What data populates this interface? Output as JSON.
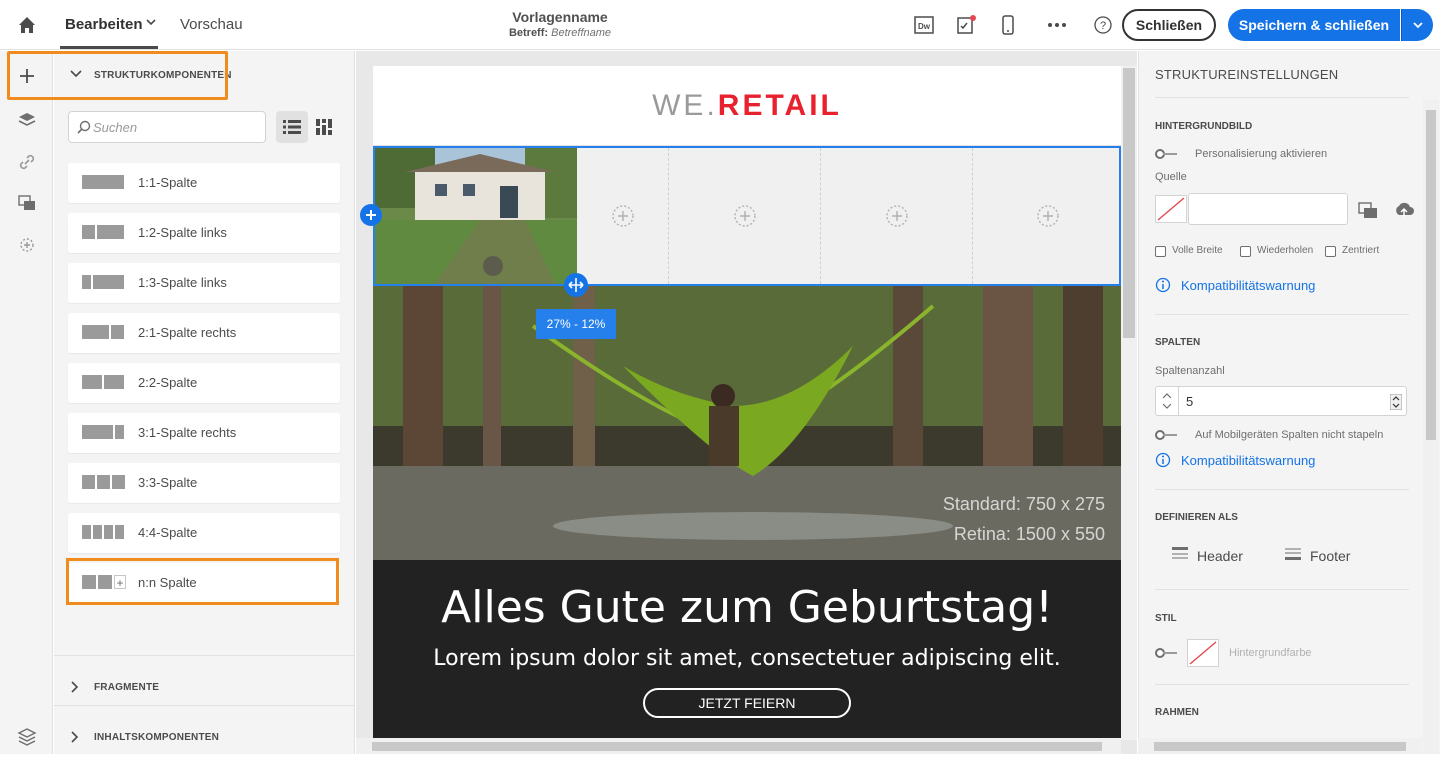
{
  "topbar": {
    "tab_edit": "Bearbeiten",
    "tab_preview": "Vorschau",
    "template_name": "Vorlagenname",
    "subject_label": "Betreff:",
    "subject_value": "Betreffname",
    "close_label": "Schließen",
    "save_label": "Speichern & schließen",
    "accent": "#1473e6"
  },
  "left_rail": {
    "icons": [
      "add-icon",
      "layers-icon",
      "link-icon",
      "image-assets-icon",
      "personalization-icon",
      "help-layers-icon"
    ]
  },
  "panel": {
    "section_structure": "STRUKTURKOMPONENTEN",
    "search_placeholder": "Suchen",
    "components": [
      {
        "label": "1:1-Spalte",
        "cols": [
          1
        ]
      },
      {
        "label": "1:2-Spalte links",
        "cols": [
          1,
          2
        ]
      },
      {
        "label": "1:3-Spalte links",
        "cols": [
          1,
          3
        ]
      },
      {
        "label": "2:1-Spalte rechts",
        "cols": [
          2,
          1
        ]
      },
      {
        "label": "2:2-Spalte",
        "cols": [
          1,
          1
        ]
      },
      {
        "label": "3:1-Spalte rechts",
        "cols": [
          3,
          1
        ]
      },
      {
        "label": "3:3-Spalte",
        "cols": [
          1,
          1,
          1
        ]
      },
      {
        "label": "4:4-Spalte",
        "cols": [
          1,
          1,
          1,
          1
        ]
      },
      {
        "label": "n:n Spalte",
        "cols": [
          1,
          1
        ]
      }
    ],
    "section_fragments": "FRAGMENTE",
    "section_content": "INHALTSKOMPONENTEN",
    "highlight_color": "#f08c1e"
  },
  "canvas": {
    "logo_we": "WE",
    "logo_dot": ".",
    "logo_retail": "RETAIL",
    "logo_accent": "#e8212e",
    "resize_tooltip": "27% - 12%",
    "image_text_standard": "Standard: 750 x 275",
    "image_text_retina": "Retina: 1500 x 550",
    "headline": "Alles Gute zum Geburtstag!",
    "paragraph": "Lorem ipsum dolor sit amet, consectetuer adipiscing elit.",
    "cta": "JETZT FEIERN"
  },
  "right_panel": {
    "title": "STRUKTUREINSTELLUNGEN",
    "bg_image_section": "HINTERGRUNDBILD",
    "personalization_toggle": "Personalisierung aktivieren",
    "source_label": "Quelle",
    "source_value": "",
    "cb_full_width": "Volle Breite",
    "cb_repeat": "Wiederholen",
    "cb_centered": "Zentriert",
    "compat_warning": "Kompatibilitätswarnung",
    "columns_section": "SPALTEN",
    "columns_count_label": "Spaltenanzahl",
    "columns_count_value": "5",
    "no_stack_toggle": "Auf Mobilgeräten Spalten nicht stapeln",
    "compat_warning_2": "Kompatibilitätswarnung",
    "define_as_section": "DEFINIEREN ALS",
    "define_header": "Header",
    "define_footer": "Footer",
    "style_section": "STIL",
    "bg_color_label": "Hintergrundfarbe",
    "border_section": "RAHMEN"
  }
}
